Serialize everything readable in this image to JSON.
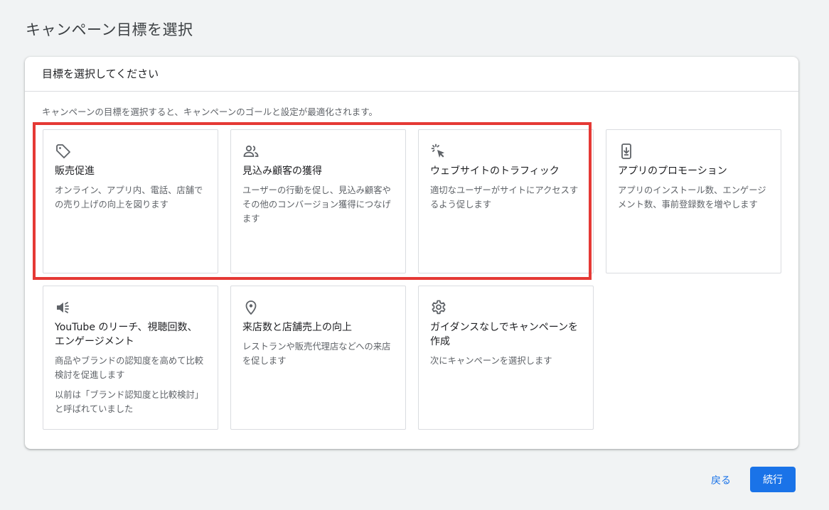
{
  "page": {
    "title": "キャンペーン目標を選択"
  },
  "card": {
    "header": "目標を選択してください",
    "description": "キャンペーンの目標を選択すると、キャンペーンのゴールと設定が最適化されます。"
  },
  "options": [
    {
      "icon": "tag-icon",
      "title": "販売促進",
      "description": "オンライン、アプリ内、電話、店舗での売り上げの向上を図ります"
    },
    {
      "icon": "people-icon",
      "title": "見込み顧客の獲得",
      "description": "ユーザーの行動を促し、見込み顧客やその他のコンバージョン獲得につなげます"
    },
    {
      "icon": "cursor-click-icon",
      "title": "ウェブサイトのトラフィック",
      "description": "適切なユーザーがサイトにアクセスするよう促します"
    },
    {
      "icon": "phone-download-icon",
      "title": "アプリのプロモーション",
      "description": "アプリのインストール数、エンゲージメント数、事前登録数を増やします"
    },
    {
      "icon": "megaphone-icon",
      "title": "YouTube のリーチ、視聴回数、エンゲージメント",
      "description": "商品やブランドの認知度を高めて比較検討を促進します",
      "note": "以前は「ブランド認知度と比較検討」と呼ばれていました"
    },
    {
      "icon": "location-pin-icon",
      "title": "来店数と店舗売上の向上",
      "description": "レストランや販売代理店などへの来店を促します"
    },
    {
      "icon": "gear-icon",
      "title": "ガイダンスなしでキャンペーンを作成",
      "description": "次にキャンペーンを選択します"
    }
  ],
  "footer": {
    "back_label": "戻る",
    "continue_label": "続行"
  },
  "colors": {
    "accent": "#1a73e8",
    "highlight": "#e53935"
  }
}
